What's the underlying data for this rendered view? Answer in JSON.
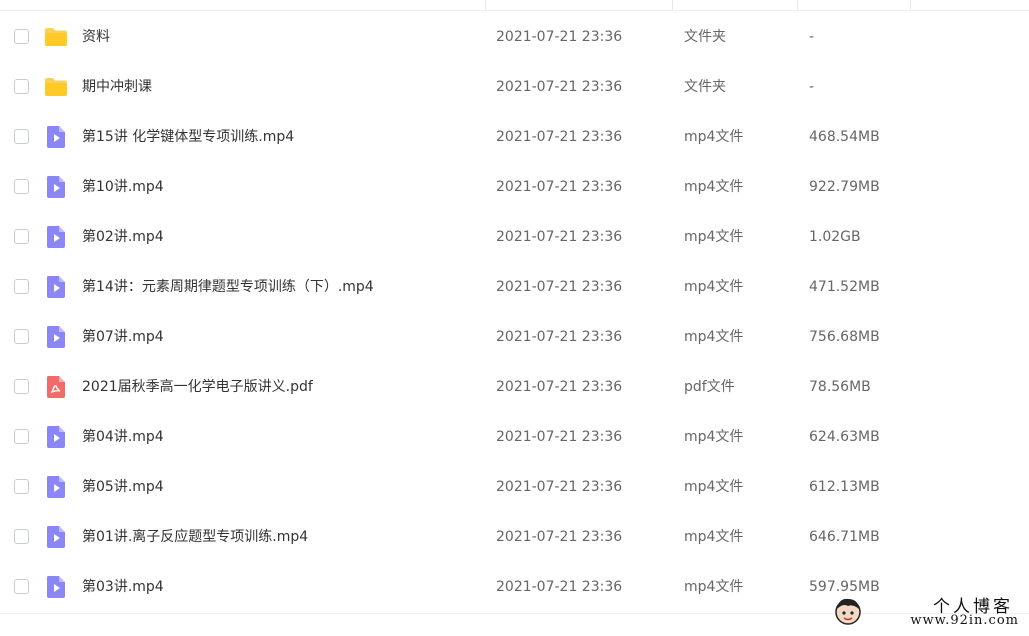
{
  "colors": {
    "folder": "#FFD24D",
    "video": "#8B86F5",
    "pdf": "#F26B6B",
    "text_primary": "#333333",
    "text_secondary": "#666666"
  },
  "files": [
    {
      "name": "资料",
      "date": "2021-07-21 23:36",
      "type": "文件夹",
      "size": "-",
      "icon": "folder-icon"
    },
    {
      "name": "期中冲刺课",
      "date": "2021-07-21 23:36",
      "type": "文件夹",
      "size": "-",
      "icon": "folder-icon"
    },
    {
      "name": "第15讲 化学键体型专项训练.mp4",
      "date": "2021-07-21 23:36",
      "type": "mp4文件",
      "size": "468.54MB",
      "icon": "video-file-icon"
    },
    {
      "name": "第10讲.mp4",
      "date": "2021-07-21 23:36",
      "type": "mp4文件",
      "size": "922.79MB",
      "icon": "video-file-icon"
    },
    {
      "name": "第02讲.mp4",
      "date": "2021-07-21 23:36",
      "type": "mp4文件",
      "size": "1.02GB",
      "icon": "video-file-icon"
    },
    {
      "name": "第14讲：元素周期律题型专项训练（下）.mp4",
      "date": "2021-07-21 23:36",
      "type": "mp4文件",
      "size": "471.52MB",
      "icon": "video-file-icon"
    },
    {
      "name": "第07讲.mp4",
      "date": "2021-07-21 23:36",
      "type": "mp4文件",
      "size": "756.68MB",
      "icon": "video-file-icon"
    },
    {
      "name": "2021届秋季高一化学电子版讲义.pdf",
      "date": "2021-07-21 23:36",
      "type": "pdf文件",
      "size": "78.56MB",
      "icon": "pdf-file-icon"
    },
    {
      "name": "第04讲.mp4",
      "date": "2021-07-21 23:36",
      "type": "mp4文件",
      "size": "624.63MB",
      "icon": "video-file-icon"
    },
    {
      "name": "第05讲.mp4",
      "date": "2021-07-21 23:36",
      "type": "mp4文件",
      "size": "612.13MB",
      "icon": "video-file-icon"
    },
    {
      "name": "第01讲.离子反应题型专项训练.mp4",
      "date": "2021-07-21 23:36",
      "type": "mp4文件",
      "size": "646.71MB",
      "icon": "video-file-icon"
    },
    {
      "name": "第03讲.mp4",
      "date": "2021-07-21 23:36",
      "type": "mp4文件",
      "size": "597.95MB",
      "icon": "video-file-icon"
    }
  ],
  "watermark": {
    "title": "个人博客",
    "url": "www.92in.com"
  }
}
